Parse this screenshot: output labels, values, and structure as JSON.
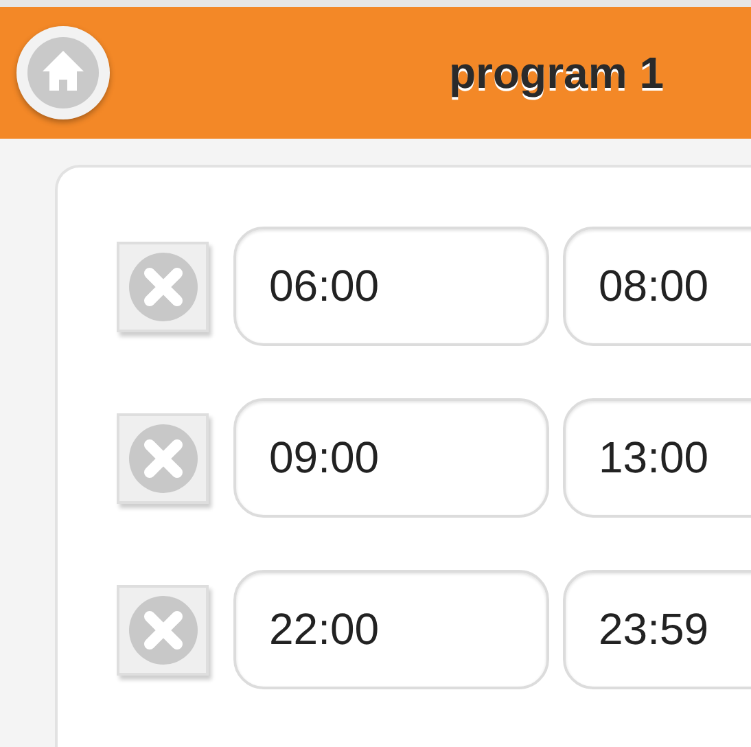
{
  "header": {
    "title": "program 1"
  },
  "slots": [
    {
      "start": "06:00",
      "end": "08:00"
    },
    {
      "start": "09:00",
      "end": "13:00"
    },
    {
      "start": "22:00",
      "end": "23:59"
    }
  ]
}
